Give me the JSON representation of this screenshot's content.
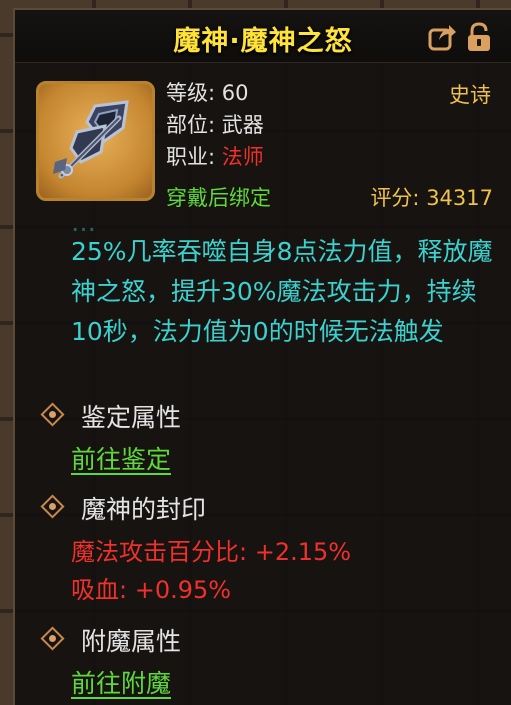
{
  "header": {
    "title": "魔神·魔神之怒"
  },
  "item": {
    "level_line": "等级: 60",
    "slot_line": "部位: 武器",
    "class_label": "职业: ",
    "class_value": "法师",
    "bind_text": "穿戴后绑定",
    "rarity": "史诗",
    "score": "评分: 34317"
  },
  "description": {
    "fade_line": "…",
    "text": "25%几率吞噬自身8点法力值，释放魔神之怒，提升30%魔法攻击力，持续10秒，法力值为0的时候无法触发"
  },
  "sections": {
    "identify": {
      "title": "鉴定属性",
      "link": "前往鉴定"
    },
    "seal": {
      "title": "魔神的封印",
      "stats": [
        "魔法攻击百分比: +2.15%",
        "吸血: +0.95%"
      ]
    },
    "enchant": {
      "title": "附魔属性",
      "link": "前往附魔"
    }
  },
  "icons": [
    "share-icon",
    "lock-icon",
    "weapon-icon",
    "diamond-bullet-icon"
  ],
  "colors": {
    "title": "#ffe23a",
    "rarity": "#f1c24a",
    "bind": "#5fd83a",
    "description": "#3bd1cf",
    "stat": "#f0302a",
    "frame": "#b8832c"
  }
}
